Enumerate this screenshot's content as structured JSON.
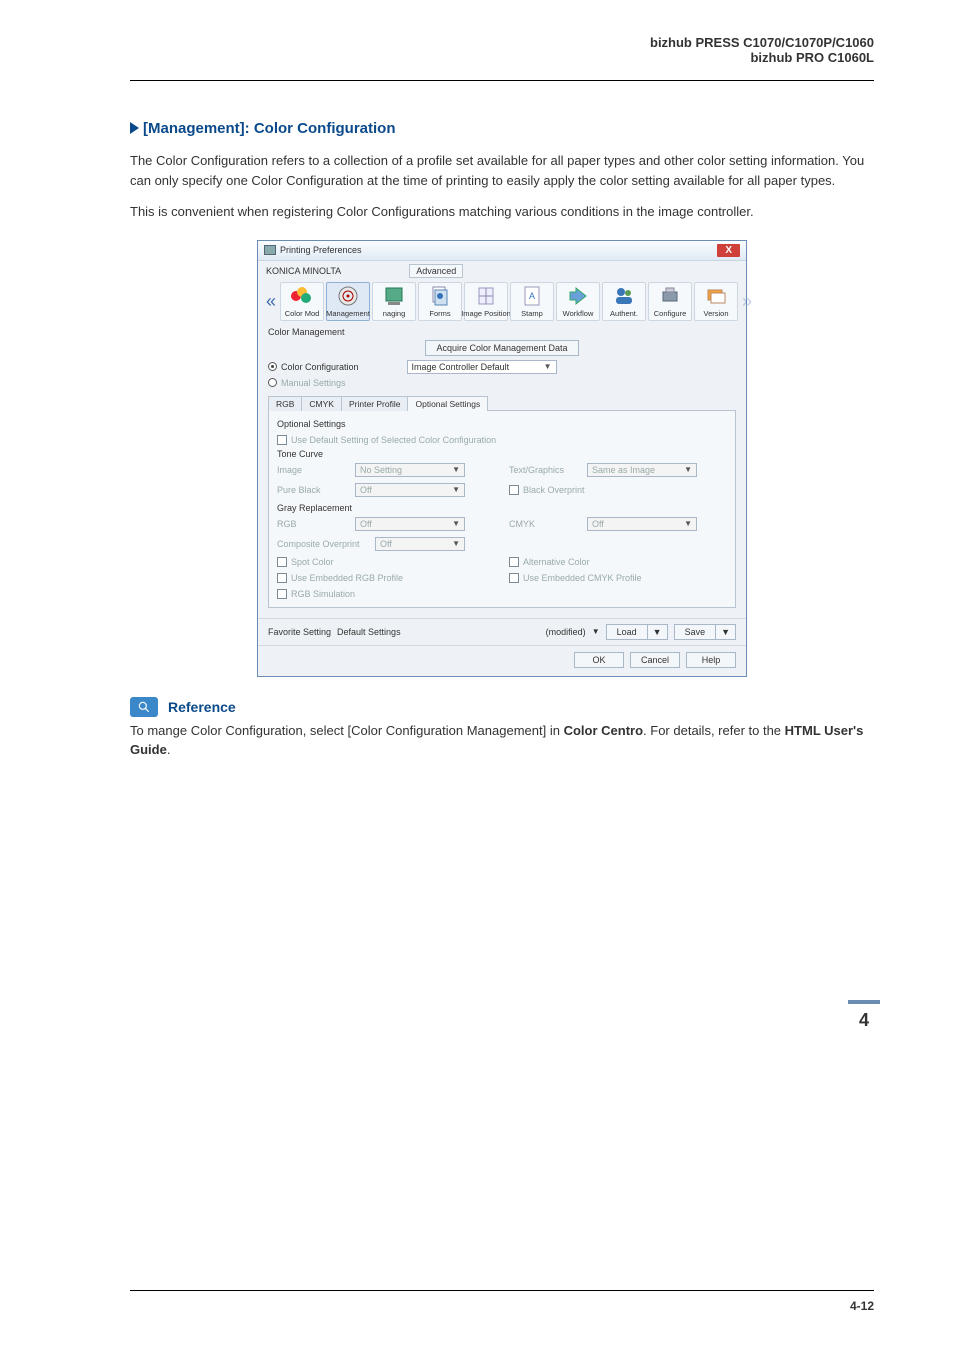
{
  "header": {
    "line1": "bizhub PRESS C1070/C1070P/C1060",
    "line2": "bizhub PRO C1060L"
  },
  "section": {
    "heading": "[Management]: Color Configuration",
    "para1": "The Color Configuration refers to a collection of a profile set available for all paper types and other color setting information. You can only specify one Color Configuration at the time of printing to easily apply the color setting available for all paper types.",
    "para2": "This is convenient when registering Color Configurations matching various conditions in the image controller."
  },
  "dialog": {
    "title": "Printing Preferences",
    "close_label": "X",
    "konica": "KONICA MINOLTA",
    "advanced": "Advanced",
    "tabs": {
      "color_mode": "Color Mod",
      "management": "Management",
      "imaging": "naging",
      "forms": "Forms",
      "image_position": "Image Position",
      "stamp": "Stamp",
      "workflow": "Workflow",
      "authent": "Authent.",
      "configure": "Configure",
      "version": "Version"
    },
    "panel": {
      "group_label": "Color Management",
      "acquire_btn": "Acquire Color Management Data",
      "radio_color_config": "Color Configuration",
      "radio_manual": "Manual Settings",
      "config_select": "Image Controller Default",
      "inner_tabs": {
        "rgb": "RGB",
        "cmyk": "CMYK",
        "printer_profile": "Printer Profile",
        "optional": "Optional Settings"
      },
      "optional": {
        "title": "Optional Settings",
        "use_default": "Use Default Setting of Selected Color Configuration",
        "tone_curve": "Tone Curve",
        "image": "Image",
        "image_val": "No Setting",
        "textgraphics": "Text/Graphics",
        "textgraphics_val": "Same as Image",
        "pure_black": "Pure Black",
        "pure_black_val": "Off",
        "black_overprint": "Black Overprint",
        "gray_replace": "Gray Replacement",
        "rgb": "RGB",
        "rgb_val": "Off",
        "cmyk": "CMYK",
        "cmyk_val": "Off",
        "comp_over": "Composite Overprint",
        "comp_over_val": "Off",
        "spot_color": "Spot Color",
        "alt_color": "Alternative Color",
        "emb_rgb": "Use Embedded RGB Profile",
        "emb_cmyk": "Use Embedded CMYK Profile",
        "rgb_sim": "RGB Simulation"
      },
      "favorite": {
        "label": "Favorite Setting",
        "value": "Default Settings",
        "modified": "(modified)",
        "load": "Load",
        "save": "Save"
      },
      "actions": {
        "ok": "OK",
        "cancel": "Cancel",
        "help": "Help"
      }
    }
  },
  "reference": {
    "label": "Reference",
    "text_prefix": "To mange Color Configuration, select [Color Configuration Management] in ",
    "bold1": "Color Centro",
    "text_mid": ". For details, refer to the ",
    "bold2": "HTML User's Guide",
    "text_end": "."
  },
  "side_page_number": "4",
  "footer_page": "4-12"
}
